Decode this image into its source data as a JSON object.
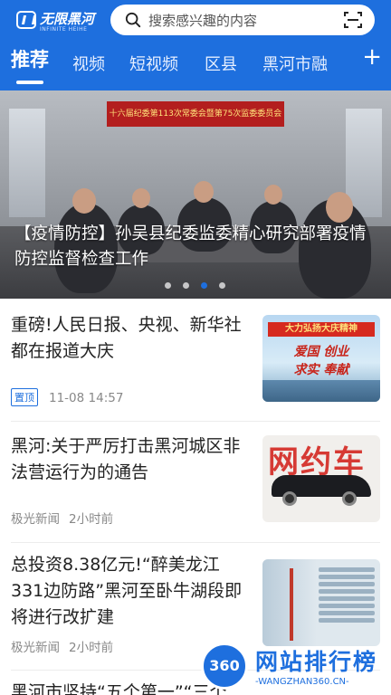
{
  "header": {
    "logo_title": "无限黑河",
    "logo_subtitle": "INFINITE HEIHE",
    "search_placeholder": "搜索感兴趣的内容",
    "tabs": [
      "推荐",
      "视频",
      "短视频",
      "区县",
      "黑河市融"
    ],
    "active_tab": 0,
    "add_tab_label": "+",
    "accent": "#1e6fde"
  },
  "banner": {
    "caption": "【疫情防控】孙吴县纪委监委精心研究部署疫情防控监督检查工作",
    "sign_text": "十六届纪委第113次常委会暨第75次监委委员会",
    "slide_count": 4,
    "active_slide": 2
  },
  "news": [
    {
      "title": "重磅!人民日报、央视、新华社都在报道大庆",
      "tag": "置顶",
      "time": "11-08 14:57",
      "thumb_banner": "大力弘扬大庆精神",
      "thumb_line1": "爱国 创业",
      "thumb_line2": "求实 奉献"
    },
    {
      "title": "黑河:关于严厉打击黑河城区非法营运行为的通告",
      "source": "极光新闻",
      "time": "2小时前",
      "thumb_text": "网约车"
    },
    {
      "title": "总投资8.38亿元!“醉美龙江331边防路”黑河至卧牛湖段即将进行改扩建",
      "source": "极光新闻",
      "time": "2小时前"
    },
    {
      "title": "黑河市坚持“五个第一”“三个"
    }
  ],
  "watermark": {
    "badge": "360",
    "title": "网站排行榜",
    "url": "-WANGZHAN360.CN-"
  }
}
